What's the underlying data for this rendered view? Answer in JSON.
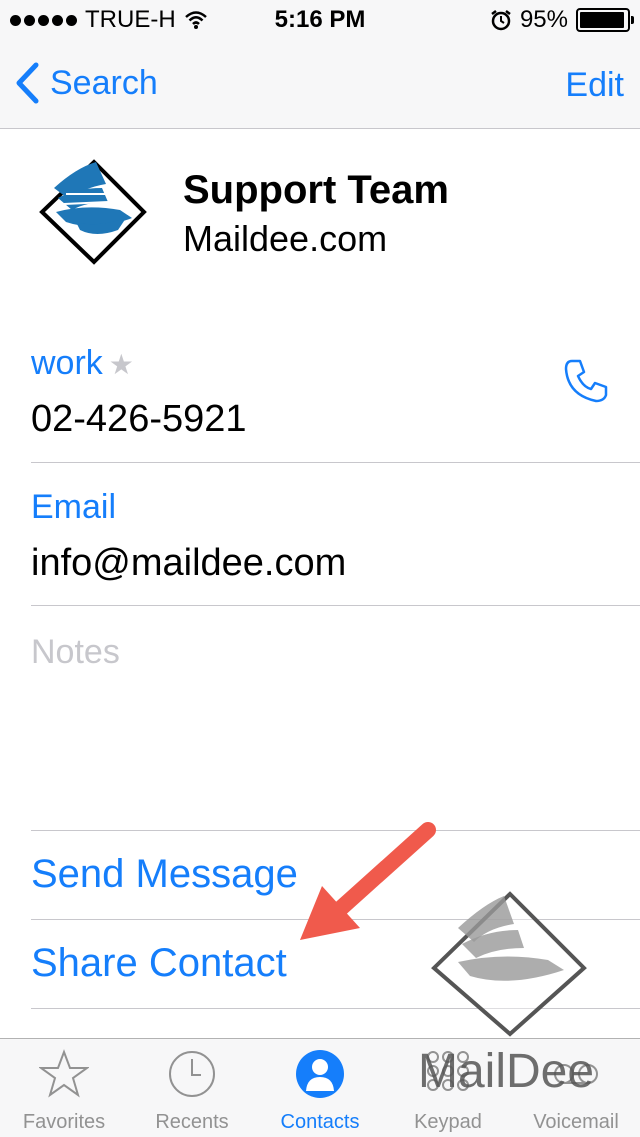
{
  "status_bar": {
    "carrier": "TRUE-H",
    "time": "5:16 PM",
    "battery": "95%",
    "battery_level": 0.95,
    "icons": [
      "signal-dots-icon",
      "wifi-icon",
      "alarm-icon",
      "battery-icon"
    ]
  },
  "nav": {
    "back_label": "Search",
    "edit_label": "Edit"
  },
  "contact": {
    "name": "Support Team",
    "company": "Maildee.com"
  },
  "fields": {
    "phone_label": "work",
    "phone_value": "02-426-5921",
    "email_label": "Email",
    "email_value": "info@maildee.com",
    "notes_label": "Notes"
  },
  "actions": {
    "send_message": "Send Message",
    "share_contact": "Share Contact"
  },
  "watermark": {
    "text": "MailDee"
  },
  "tabs": [
    {
      "label": "Favorites",
      "icon": "star-icon"
    },
    {
      "label": "Recents",
      "icon": "clock-icon"
    },
    {
      "label": "Contacts",
      "icon": "contacts-icon"
    },
    {
      "label": "Keypad",
      "icon": "keypad-icon"
    },
    {
      "label": "Voicemail",
      "icon": "voicemail-icon"
    }
  ],
  "colors": {
    "accent": "#157efb",
    "annotation_arrow": "#f05a4c",
    "logo_blue": "#1f77b7"
  }
}
